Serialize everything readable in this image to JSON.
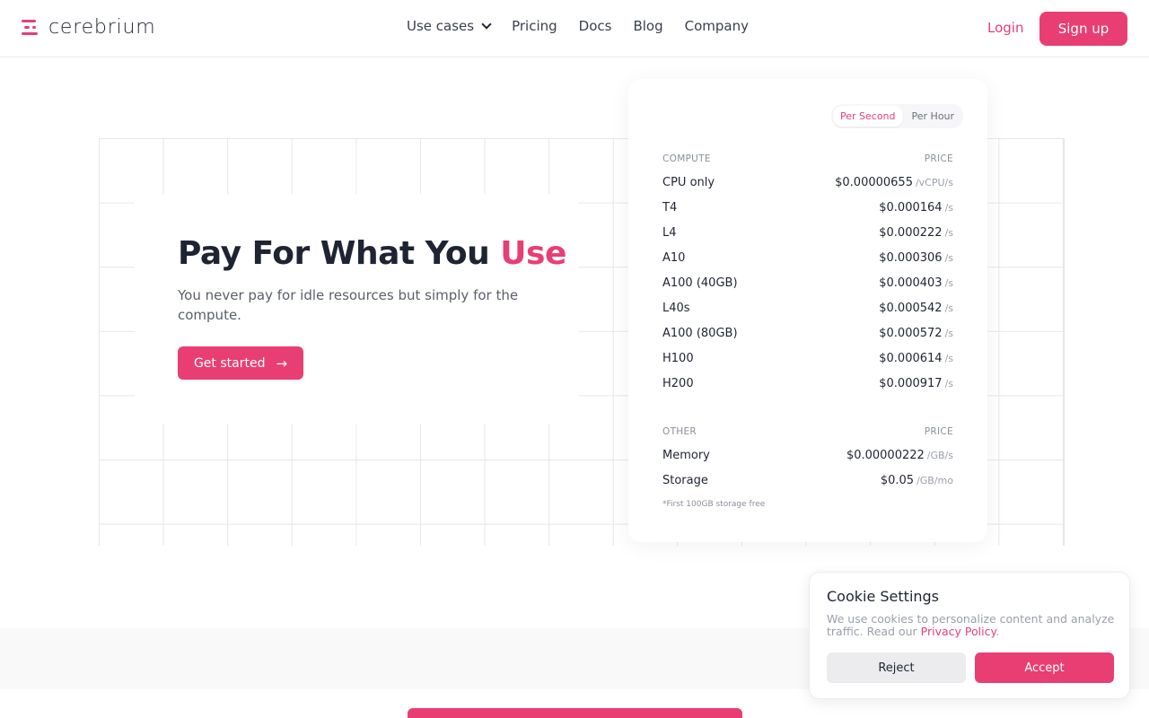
{
  "brand": {
    "name": "cerebrium",
    "accent": "#e83e74"
  },
  "nav": {
    "items": [
      {
        "label": "Use cases",
        "dropdown": true
      },
      {
        "label": "Pricing"
      },
      {
        "label": "Docs"
      },
      {
        "label": "Blog"
      },
      {
        "label": "Company"
      }
    ],
    "login": "Login",
    "signup": "Sign up"
  },
  "hero": {
    "title_main": "Pay For What You ",
    "title_accent": "Use",
    "subtitle": "You never pay for idle resources but simply for the compute.",
    "cta": "Get started",
    "cta_icon": "arrow-right-icon"
  },
  "pricing": {
    "toggle": {
      "options": [
        "Per Second",
        "Per Hour"
      ],
      "selected": "Per Second"
    },
    "compute": {
      "header_left": "COMPUTE",
      "header_right": "PRICE",
      "rows": [
        {
          "name": "CPU only",
          "price": "$0.00000655",
          "unit": "/vCPU/s"
        },
        {
          "name": "T4",
          "price": "$0.000164",
          "unit": "/s"
        },
        {
          "name": "L4",
          "price": "$0.000222",
          "unit": "/s"
        },
        {
          "name": "A10",
          "price": "$0.000306",
          "unit": "/s"
        },
        {
          "name": "A100 (40GB)",
          "price": "$0.000403",
          "unit": "/s"
        },
        {
          "name": "L40s",
          "price": "$0.000542",
          "unit": "/s"
        },
        {
          "name": "A100 (80GB)",
          "price": "$0.000572",
          "unit": "/s"
        },
        {
          "name": "H100",
          "price": "$0.000614",
          "unit": "/s"
        },
        {
          "name": "H200",
          "price": "$0.000917",
          "unit": "/s"
        }
      ]
    },
    "other": {
      "header_left": "OTHER",
      "header_right": "PRICE",
      "rows": [
        {
          "name": "Memory",
          "price": "$0.00000222",
          "unit": "/GB/s"
        },
        {
          "name": "Storage",
          "price": "$0.05",
          "unit": "/GB/mo"
        }
      ]
    },
    "footnote": "*First 100GB storage free"
  },
  "cookie": {
    "title": "Cookie Settings",
    "text": "We use cookies to personalize content and analyze traffic. Read our ",
    "link": "Privacy Policy",
    "text_end": ".",
    "reject": "Reject",
    "accept": "Accept"
  }
}
